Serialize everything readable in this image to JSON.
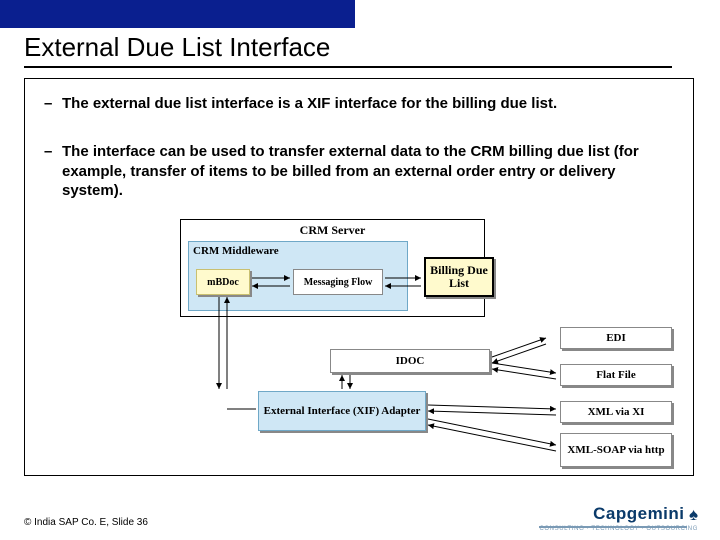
{
  "slide": {
    "title": "External Due List Interface",
    "bullets": [
      "The external due list interface is a XIF interface for the billing due list.",
      "The interface can be used to transfer external data to the CRM billing due list (for example, transfer of items to be billed from an external order entry or delivery system)."
    ]
  },
  "diagram": {
    "crm_server": "CRM Server",
    "crm_middleware": "CRM Middleware",
    "mbdoc": "mBDoc",
    "messaging_flow": "Messaging Flow",
    "billing_due_list": "Billing Due List",
    "idoc": "IDOC",
    "xif_adapter": "External Interface (XIF) Adapter",
    "edi": "EDI",
    "flat_file": "Flat File",
    "xml_via_xi": "XML via XI",
    "xml_soap": "XML-SOAP via http"
  },
  "footer": {
    "copyright": "© India SAP Co. E, Slide 36",
    "logo_name": "Capgemini",
    "logo_tag": "CONSULTING · TECHNOLOGY · OUTSOURCING"
  }
}
